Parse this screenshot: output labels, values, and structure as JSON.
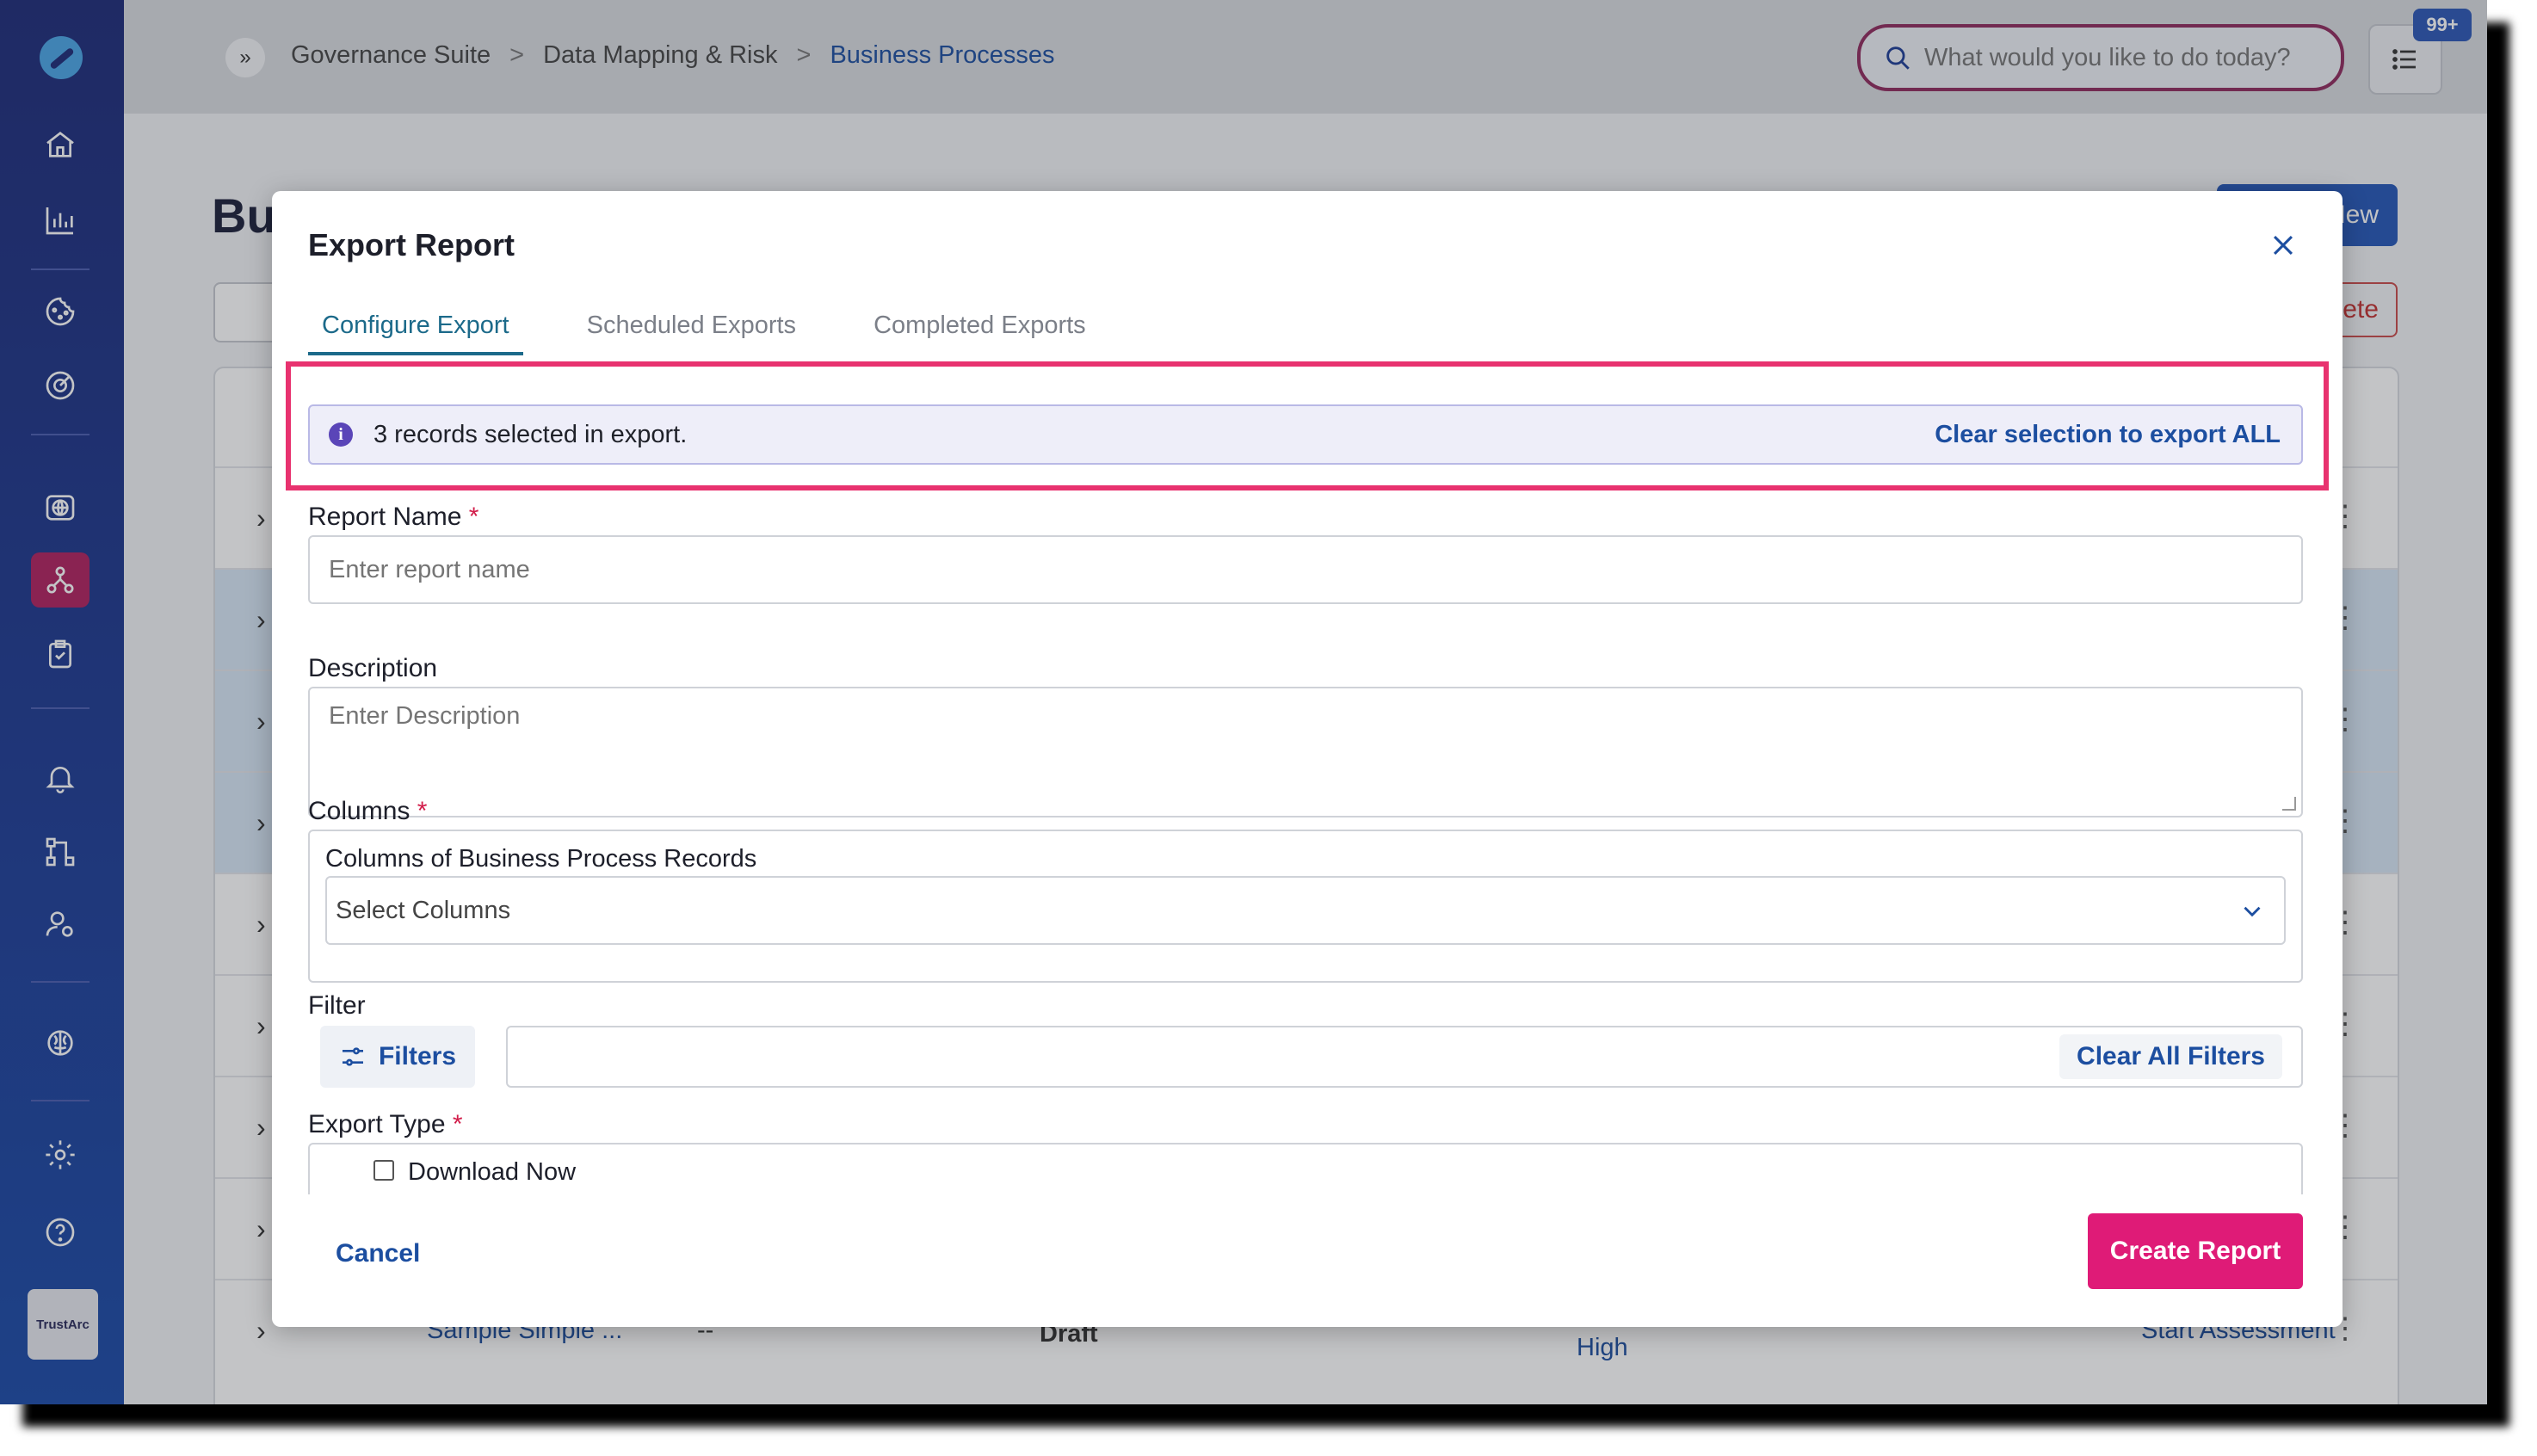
{
  "breadcrumb": {
    "items": [
      "Governance Suite",
      "Data Mapping & Risk",
      "Business Processes"
    ],
    "separator": ">"
  },
  "search": {
    "placeholder": "What would you like to do today?"
  },
  "notifications": {
    "badge": "99+"
  },
  "sidebar": {
    "brand_label": "TrustArc",
    "icons": [
      "home-icon",
      "bar-chart-icon",
      "cookie-icon",
      "target-icon",
      "globe-icon",
      "network-icon",
      "clipboard-check-icon",
      "bell-icon",
      "workflow-icon",
      "user-settings-icon",
      "brain-icon",
      "gear-icon",
      "help-icon"
    ]
  },
  "background_page": {
    "title": "Bu",
    "new_button": "New",
    "delete_button": "ete",
    "row_name": "Sample Simple ...",
    "row_dash": "--",
    "row_status": "Draft",
    "row_risk": "High",
    "row_action": "Start Assessment"
  },
  "modal": {
    "title": "Export Report",
    "tabs": [
      {
        "label": "Configure Export",
        "active": true
      },
      {
        "label": "Scheduled Exports",
        "active": false
      },
      {
        "label": "Completed Exports",
        "active": false
      }
    ],
    "info_banner": {
      "text": "3 records selected in export.",
      "link": "Clear selection to export ALL"
    },
    "report_name": {
      "label": "Report Name",
      "required": "*",
      "placeholder": "Enter report name"
    },
    "description": {
      "label": "Description",
      "placeholder": "Enter Description"
    },
    "columns": {
      "label": "Columns",
      "required": "*",
      "sublabel": "Columns of Business Process Records",
      "placeholder": "Select Columns"
    },
    "filter": {
      "label": "Filter",
      "button": "Filters",
      "clear": "Clear All Filters"
    },
    "export_type": {
      "label": "Export Type",
      "required": "*",
      "option": "Download Now"
    },
    "cancel": "Cancel",
    "create": "Create Report"
  },
  "colors": {
    "sidebar": "#1d2a78",
    "accent_blue": "#1c4ea0",
    "primary_pink": "#df1b77",
    "highlight": "#e8326f",
    "active_tab": "#1c6a8a"
  }
}
